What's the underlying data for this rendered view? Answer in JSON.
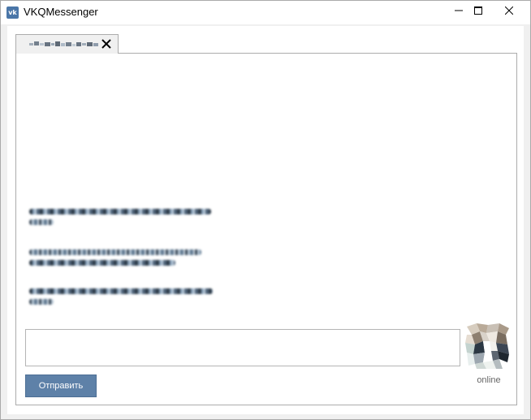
{
  "window": {
    "title": "VKQMessenger",
    "app_icon": "vk-logo-icon",
    "brand_color": "#4a76a8"
  },
  "tab": {
    "label_icon": "redacted-contact-name",
    "close_icon": "close-icon"
  },
  "messages": [
    {
      "content": "redacted-message-text"
    },
    {
      "content": "redacted-message-text"
    },
    {
      "content": "redacted-message-text"
    }
  ],
  "composer": {
    "value": "",
    "placeholder": ""
  },
  "contact": {
    "avatar_icon": "contact-avatar-icon",
    "status": "online"
  },
  "actions": {
    "send_label": "Отправить",
    "send_color": "#5e81a8"
  }
}
